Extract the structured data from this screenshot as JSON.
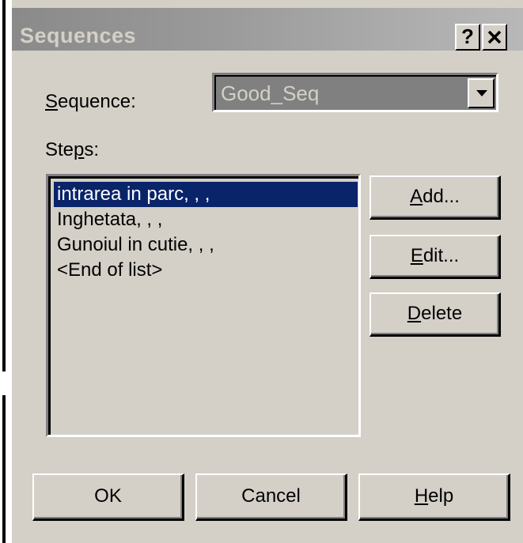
{
  "window": {
    "title": "Sequences",
    "help_button": "?",
    "close_button": "✕"
  },
  "sequence": {
    "label_accel": "S",
    "label_rest": "equence:",
    "value": "Good_Seq"
  },
  "steps": {
    "label_pre": "Ste",
    "label_accel": "p",
    "label_post": "s:",
    "items": [
      "intrarea in parc, , ,",
      "Inghetata, , ,",
      "Gunoiul in cutie, , ,",
      "<End of list>"
    ],
    "selected_index": 0
  },
  "side_buttons": {
    "add_accel": "A",
    "add_rest": "dd...",
    "edit_accel": "E",
    "edit_rest": "dit...",
    "delete_accel": "D",
    "delete_rest": "elete"
  },
  "bottom_buttons": {
    "ok": "OK",
    "cancel": "Cancel",
    "help_accel": "H",
    "help_rest": "elp"
  }
}
